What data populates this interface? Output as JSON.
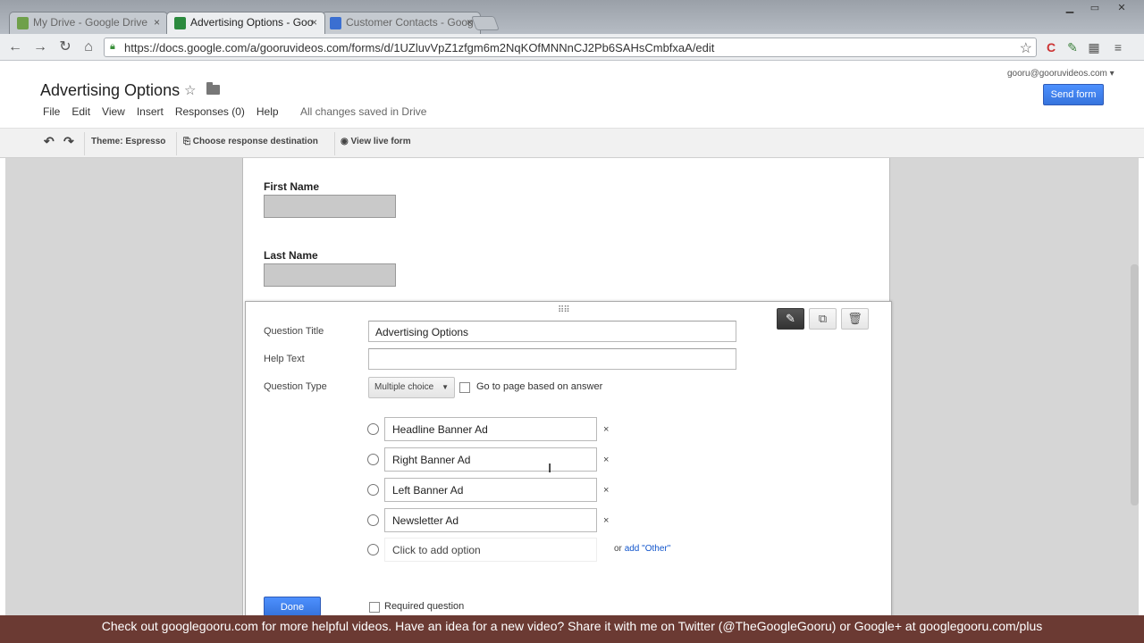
{
  "browser": {
    "tabs": [
      {
        "title": "My Drive - Google Drive",
        "active": false,
        "icon": "drive-icon",
        "color": "#6fa04a"
      },
      {
        "title": "Advertising Options - Goo",
        "active": true,
        "icon": "forms-icon",
        "color": "#2b8a3e"
      },
      {
        "title": "Customer Contacts - Goog",
        "active": false,
        "icon": "docs-icon",
        "color": "#3b6fd1"
      }
    ],
    "close_glyph": "×",
    "url": "https://docs.google.com/a/gooruvideos.com/forms/d/1UZluvVpZ1zfgm6m2NqKOfMNNnCJ2Pb6SAHsCmbfxaA/edit",
    "window_controls": [
      "▁",
      "▭",
      "✕"
    ]
  },
  "header": {
    "title": "Advertising Options",
    "star": "☆",
    "account": "gooru@gooruvideos.com ▾",
    "send_label": "Send form",
    "menu": [
      "File",
      "Edit",
      "View",
      "Insert",
      "Responses (0)",
      "Help"
    ],
    "save_status": "All changes saved in Drive"
  },
  "editbar": {
    "undo": "↶",
    "redo": "↷",
    "theme": "Theme: Espresso",
    "destination": "Choose response destination",
    "view_live": "View live form"
  },
  "form": {
    "questions": [
      {
        "label": "First Name"
      },
      {
        "label": "Last Name"
      }
    ],
    "editor": {
      "handle": "⠿⠿",
      "title_label": "Question Title",
      "title_value": "Advertising Options",
      "help_label": "Help Text",
      "help_value": "",
      "type_label": "Question Type",
      "type_value": "Multiple choice",
      "goto_label": "Go to page based on answer",
      "options": [
        "Headline Banner Ad",
        "Right Banner Ad",
        "Left Banner Ad",
        "Newsletter Ad"
      ],
      "remove_glyph": "×",
      "add_option": "Click to add option",
      "add_other_prefix": "or",
      "add_other": "add \"Other\"",
      "done_label": "Done",
      "required_label": "Required question"
    }
  },
  "banner": {
    "text": "Check out googlegooru.com for more helpful videos. Have an idea for a new video? Share it with me on Twitter (@TheGoogleGooru) or Google+ at googlegooru.com/plus"
  },
  "colors": {
    "accent": "#4d90fe",
    "banner": "#6b3a33",
    "canvas": "#d6d6d6"
  }
}
